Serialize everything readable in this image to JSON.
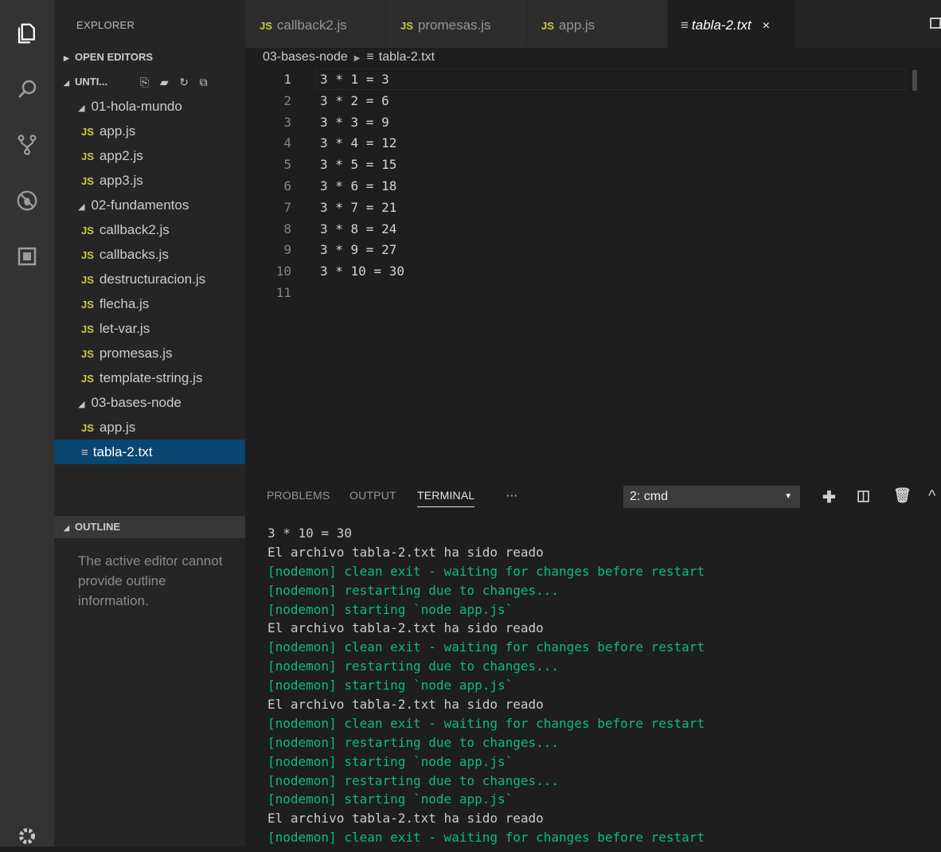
{
  "sidebar": {
    "title": "EXPLORER",
    "open_editors": "OPEN EDITORS",
    "workspace": "UNTI...",
    "tree": [
      {
        "type": "folder",
        "label": "01-hola-mundo"
      },
      {
        "type": "js",
        "label": "app.js"
      },
      {
        "type": "js",
        "label": "app2.js"
      },
      {
        "type": "js",
        "label": "app3.js"
      },
      {
        "type": "folder",
        "label": "02-fundamentos"
      },
      {
        "type": "js",
        "label": "callback2.js"
      },
      {
        "type": "js",
        "label": "callbacks.js"
      },
      {
        "type": "js",
        "label": "destructuracion.js"
      },
      {
        "type": "js",
        "label": "flecha.js"
      },
      {
        "type": "js",
        "label": "let-var.js"
      },
      {
        "type": "js",
        "label": "promesas.js"
      },
      {
        "type": "js",
        "label": "template-string.js"
      },
      {
        "type": "folder",
        "label": "03-bases-node"
      },
      {
        "type": "js",
        "label": "app.js"
      },
      {
        "type": "txt",
        "label": "tabla-2.txt",
        "selected": true
      }
    ],
    "outline": "OUTLINE",
    "outline_message": "The active editor cannot provide outline information."
  },
  "tabs": [
    {
      "label": "callback2.js",
      "icon": "JS"
    },
    {
      "label": "promesas.js",
      "icon": "JS"
    },
    {
      "label": "app.js",
      "icon": "JS"
    },
    {
      "label": "tabla-2.txt",
      "icon": "≡",
      "active": true,
      "close": "×"
    }
  ],
  "breadcrumb": {
    "folder": "03-bases-node",
    "file": "tabla-2.txt"
  },
  "editor": {
    "lines": [
      {
        "n": "1",
        "text": "3 * 1 = 3"
      },
      {
        "n": "2",
        "text": "3 * 2 = 6"
      },
      {
        "n": "3",
        "text": "3 * 3 = 9"
      },
      {
        "n": "4",
        "text": "3 * 4 = 12"
      },
      {
        "n": "5",
        "text": "3 * 5 = 15"
      },
      {
        "n": "6",
        "text": "3 * 6 = 18"
      },
      {
        "n": "7",
        "text": "3 * 7 = 21"
      },
      {
        "n": "8",
        "text": "3 * 8 = 24"
      },
      {
        "n": "9",
        "text": "3 * 9 = 27"
      },
      {
        "n": "10",
        "text": "3 * 10 = 30"
      },
      {
        "n": "11",
        "text": ""
      }
    ]
  },
  "panel": {
    "tabs": [
      "PROBLEMS",
      "OUTPUT",
      "TERMINAL",
      "···"
    ],
    "terminal_select": "2: cmd",
    "terminal": [
      {
        "text": "3 * 10 = 30",
        "color": "white"
      },
      {
        "text": "El archivo tabla-2.txt ha sido reado",
        "color": "white"
      },
      {
        "text": "[nodemon] clean exit - waiting for changes before restart",
        "color": "green"
      },
      {
        "text": "[nodemon] restarting due to changes...",
        "color": "green"
      },
      {
        "text": "[nodemon] starting `node app.js`",
        "color": "green"
      },
      {
        "text": "El archivo tabla-2.txt ha sido reado",
        "color": "white"
      },
      {
        "text": "[nodemon] clean exit - waiting for changes before restart",
        "color": "green"
      },
      {
        "text": "[nodemon] restarting due to changes...",
        "color": "green"
      },
      {
        "text": "[nodemon] starting `node app.js`",
        "color": "green"
      },
      {
        "text": "El archivo tabla-2.txt ha sido reado",
        "color": "white"
      },
      {
        "text": "[nodemon] clean exit - waiting for changes before restart",
        "color": "green"
      },
      {
        "text": "[nodemon] restarting due to changes...",
        "color": "green"
      },
      {
        "text": "[nodemon] starting `node app.js`",
        "color": "green"
      },
      {
        "text": "[nodemon] restarting due to changes...",
        "color": "green"
      },
      {
        "text": "[nodemon] starting `node app.js`",
        "color": "green"
      },
      {
        "text": "El archivo tabla-2.txt ha sido reado",
        "color": "white"
      },
      {
        "text": "[nodemon] clean exit - waiting for changes before restart",
        "color": "green"
      }
    ]
  },
  "colors": {
    "accent": "#094771",
    "terminal_green": "#0dbc79",
    "js_badge": "#cbcb41"
  }
}
